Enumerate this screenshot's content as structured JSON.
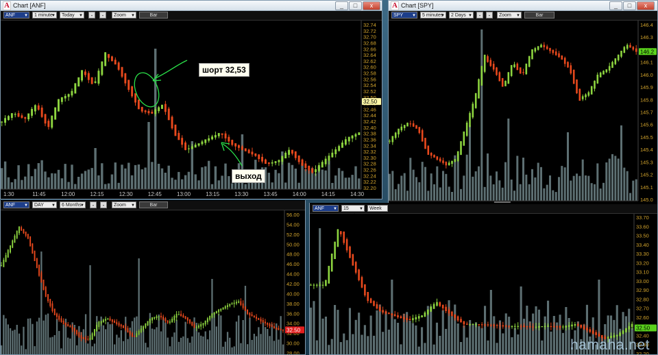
{
  "colors": {
    "up": "#8dd43f",
    "down": "#e8491d",
    "volume": "#5d6f72",
    "axis": "#d4a52d",
    "price_flag_yellow": "#fff9a8",
    "price_flag_red": "#e11e1e",
    "price_flag_green": "#5ad21c",
    "annotation": "#2be34a"
  },
  "anf_chart": {
    "title": "Chart [ANF]",
    "toolbar": {
      "symbol": "ANF",
      "interval": "1 minute",
      "range": "Today",
      "zoom": "Zoom",
      "type": "Bar",
      "minus1": "-",
      "minus2": "-"
    },
    "y_ticks": [
      "32.74",
      "32.72",
      "32.70",
      "32.68",
      "32.66",
      "32.64",
      "32.62",
      "32.60",
      "32.58",
      "32.56",
      "32.54",
      "32.52",
      "32.50",
      "32.48",
      "32.46",
      "32.44",
      "32.42",
      "32.40",
      "32.38",
      "32.36",
      "32.34",
      "32.32",
      "32.30",
      "32.28",
      "32.26",
      "32.24",
      "32.22",
      "32.20"
    ],
    "price_flag": "32.50",
    "x_ticks": [
      "1:30",
      "11:45",
      "12:00",
      "12:15",
      "12:30",
      "12:45",
      "13:00",
      "13:15",
      "13:30",
      "13:45",
      "14:00",
      "14:15",
      "14:30"
    ],
    "annotation_short": "шорт 32,53",
    "annotation_exit": "выход"
  },
  "spy_chart": {
    "title": "Chart [SPY]",
    "toolbar": {
      "symbol": "SPY",
      "interval": "5 minutes",
      "range": "2 Days",
      "zoom": "Zoom",
      "type": "Bar",
      "minus1": "-",
      "minus2": "-"
    },
    "y_ticks": [
      "146.4",
      "146.3",
      "146.2",
      "146.1",
      "146.0",
      "145.9",
      "145.8",
      "145.7",
      "145.6",
      "145.5",
      "145.4",
      "145.3",
      "145.2",
      "145.1",
      "145.0"
    ],
    "price_flag": "146.2",
    "x_ticks": [
      "13:00",
      "14:00",
      "15:00",
      "Wed",
      "10:30",
      "11:00",
      "12:00",
      "13:00",
      "14:00",
      "15:00"
    ]
  },
  "daily_chart": {
    "toolbar": {
      "symbol": "ANF",
      "interval": "DAY",
      "range": "6 Months",
      "zoom": "Zoom",
      "type": "Bar",
      "minus1": "-",
      "minus2": "-"
    },
    "y_ticks": [
      "56.00",
      "54.00",
      "52.00",
      "50.00",
      "48.00",
      "46.00",
      "44.00",
      "42.00",
      "40.00",
      "38.00",
      "36.00",
      "34.00",
      "32.00",
      "30.00",
      "28.00"
    ],
    "price_flag": "32.50"
  },
  "m15_chart": {
    "toolbar": {
      "symbol": "ANF",
      "interval": "15 minute",
      "range": "Week"
    },
    "y_ticks": [
      "33.70",
      "33.60",
      "33.50",
      "33.40",
      "33.30",
      "33.20",
      "33.10",
      "33.00",
      "32.90",
      "32.80",
      "32.70",
      "32.60",
      "32.50",
      "32.40",
      "32.30",
      "32.20"
    ],
    "price_flag": "32.50"
  },
  "watermark": "hamaha.net",
  "window_controls": {
    "minimize": "_",
    "maximize": "□",
    "close": "x"
  }
}
